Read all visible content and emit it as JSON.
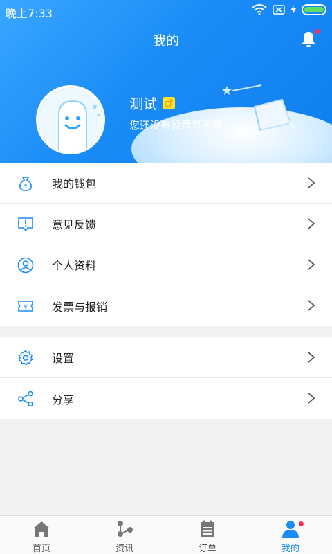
{
  "status_bar": {
    "time": "晚上7:33"
  },
  "header": {
    "title": "我的"
  },
  "profile": {
    "name": "测试",
    "signature": "您还没有设置签名哦"
  },
  "menu_group_1": [
    {
      "label": "我的钱包",
      "icon": "wallet-icon"
    },
    {
      "label": "意见反馈",
      "icon": "feedback-icon"
    },
    {
      "label": "个人资料",
      "icon": "profile-icon"
    },
    {
      "label": "发票与报销",
      "icon": "invoice-icon"
    }
  ],
  "menu_group_2": [
    {
      "label": "设置",
      "icon": "gear-icon"
    },
    {
      "label": "分享",
      "icon": "share-icon"
    }
  ],
  "tabbar": [
    {
      "label": "首页",
      "icon": "home-icon"
    },
    {
      "label": "资讯",
      "icon": "news-icon"
    },
    {
      "label": "订单",
      "icon": "orders-icon"
    },
    {
      "label": "我的",
      "icon": "user-icon",
      "active": true
    }
  ],
  "colors": {
    "primary": "#1a8cf7",
    "badge": "#ff2d55",
    "gender_badge": "#ffe22b"
  }
}
